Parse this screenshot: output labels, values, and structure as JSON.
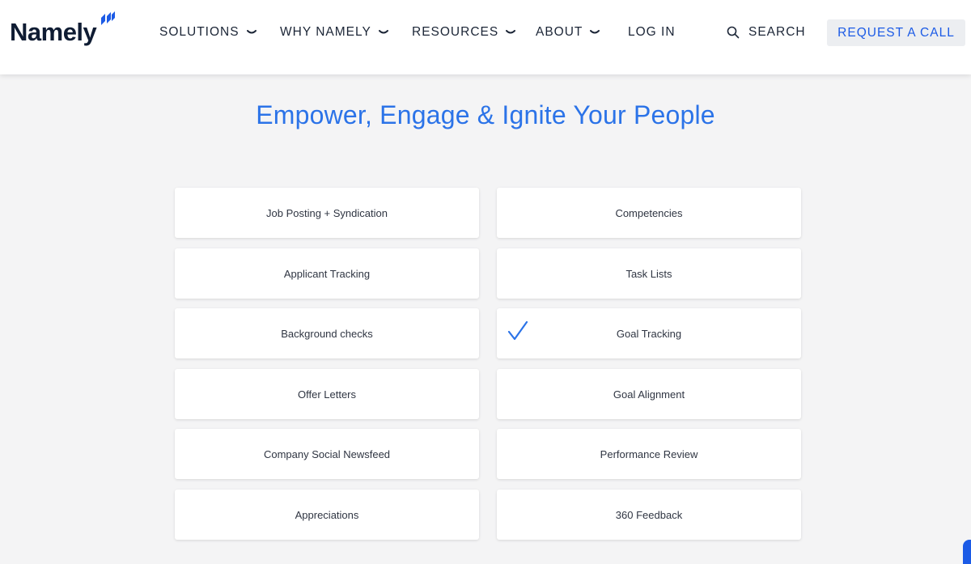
{
  "brand": {
    "name": "Namely",
    "accent": "#2b73e8"
  },
  "nav": {
    "solutions": "SOLUTIONS",
    "why": "WHY NAMELY",
    "resources": "RESOURCES",
    "about": "ABOUT",
    "login": "LOG IN",
    "search": "SEARCH",
    "cta": "REQUEST A CALL"
  },
  "hero": {
    "title": "Empower, Engage & Ignite Your People"
  },
  "features": {
    "left": [
      "Job Posting + Syndication",
      "Applicant Tracking",
      "Background checks",
      "Offer Letters",
      "Company Social Newsfeed",
      "Appreciations"
    ],
    "right": [
      "Competencies",
      "Task Lists",
      "Goal Tracking",
      "Goal Alignment",
      "Performance Review",
      "360 Feedback"
    ],
    "selected": "Goal Tracking"
  },
  "icons": {
    "search": "search-icon",
    "chevron": "chevron-down-icon",
    "check": "check-icon",
    "logo": "namely-logo-mark"
  }
}
